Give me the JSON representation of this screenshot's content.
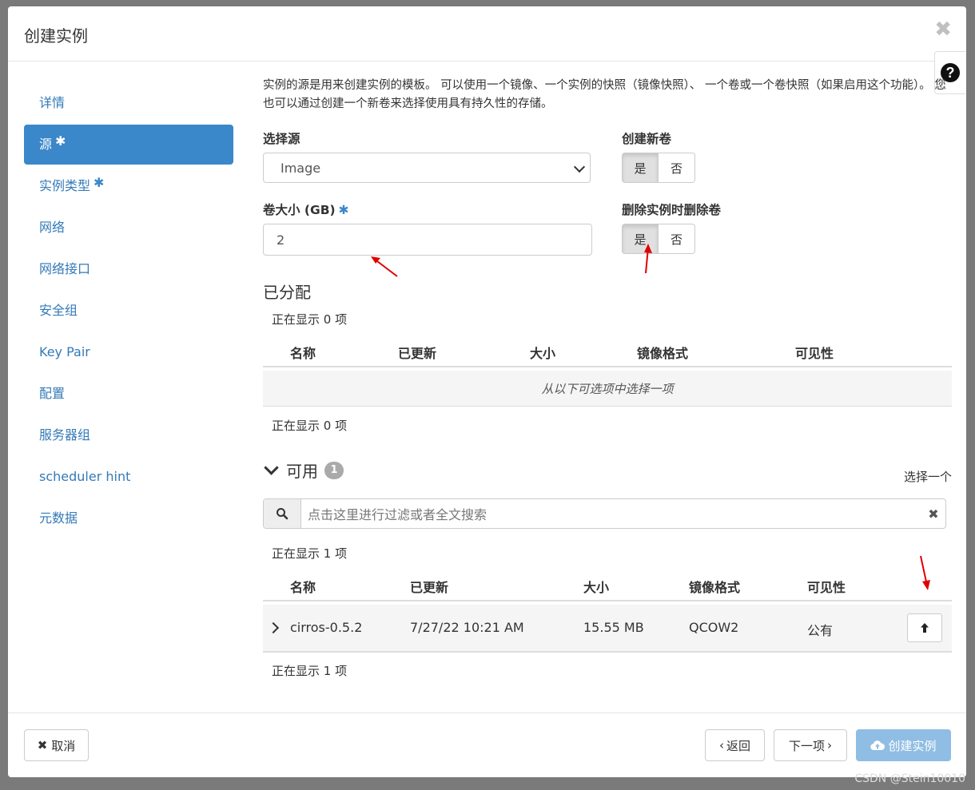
{
  "modal": {
    "title": "创建实例",
    "close": "✖"
  },
  "help": {
    "label": "?"
  },
  "sidebar": {
    "items": [
      {
        "label": "详情",
        "required": false
      },
      {
        "label": "源",
        "required": true
      },
      {
        "label": "实例类型",
        "required": true
      },
      {
        "label": "网络",
        "required": false
      },
      {
        "label": "网络接口",
        "required": false
      },
      {
        "label": "安全组",
        "required": false
      },
      {
        "label": "Key Pair",
        "required": false
      },
      {
        "label": "配置",
        "required": false
      },
      {
        "label": "服务器组",
        "required": false
      },
      {
        "label": "scheduler hint",
        "required": false
      },
      {
        "label": "元数据",
        "required": false
      }
    ],
    "required_mark": "✱"
  },
  "source": {
    "intro": "实例的源是用来创建实例的模板。 可以使用一个镜像、一个实例的快照（镜像快照）、 一个卷或一个卷快照（如果启用这个功能）。 您也可以通过创建一个新卷来选择使用具有持久性的存储。",
    "select_label": "选择源",
    "select_value": "Image",
    "new_volume_label": "创建新卷",
    "new_volume_yes": "是",
    "new_volume_no": "否",
    "volume_size_label": "卷大小 (GB)",
    "volume_size_value": "2",
    "delete_volume_label": "删除实例时删除卷",
    "delete_volume_yes": "是",
    "delete_volume_no": "否"
  },
  "allocated": {
    "title": "已分配",
    "count_top": "正在显示 0 项",
    "count_bottom": "正在显示 0 项",
    "columns": [
      "名称",
      "已更新",
      "大小",
      "镜像格式",
      "可见性"
    ],
    "empty_text": "从以下可选项中选择一项"
  },
  "available": {
    "title": "可用",
    "badge": "1",
    "select_one": "选择一个",
    "search_placeholder": "点击这里进行过滤或者全文搜索",
    "count_top": "正在显示 1 项",
    "count_bottom": "正在显示 1 项",
    "columns": [
      "名称",
      "已更新",
      "大小",
      "镜像格式",
      "可见性"
    ],
    "rows": [
      {
        "name": "cirros-0.5.2",
        "updated": "7/27/22 10:21 AM",
        "size": "15.55 MB",
        "format": "QCOW2",
        "visibility": "公有"
      }
    ]
  },
  "footer": {
    "cancel": "取消",
    "back": "返回",
    "next": "下一项",
    "create": "创建实例"
  },
  "watermark": "CSDN @Stein10010",
  "colors": {
    "accent": "#3a87c9",
    "primary_disabled": "#8fbde3",
    "annotation_arrow": "#e00000"
  }
}
